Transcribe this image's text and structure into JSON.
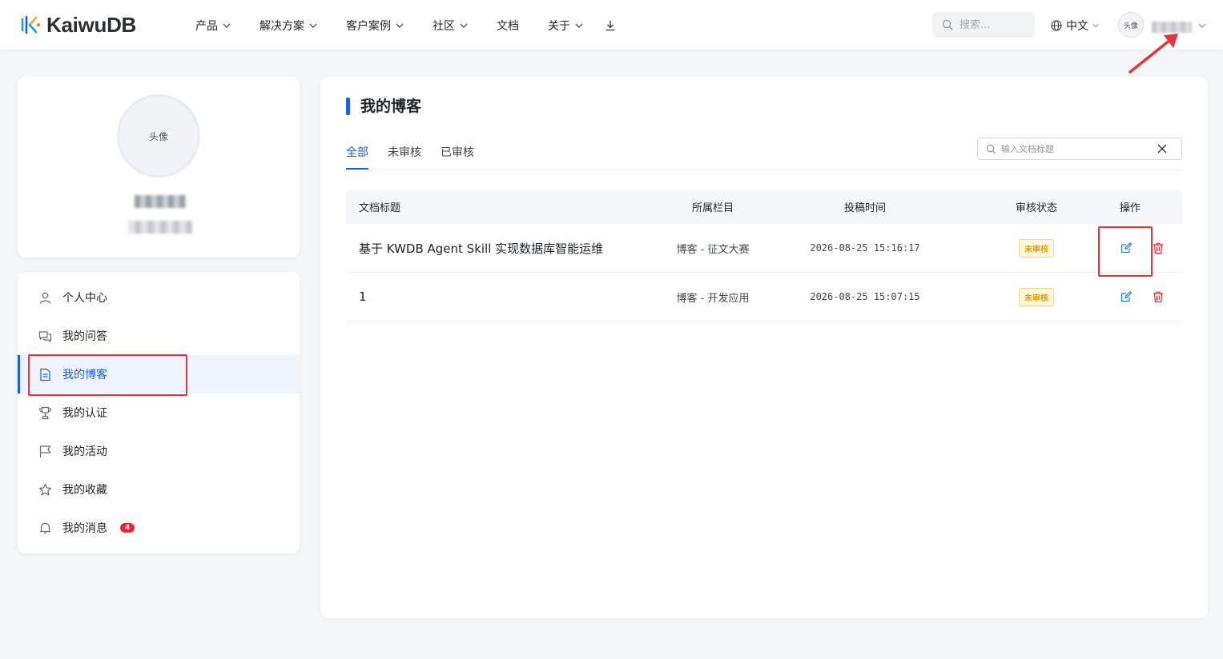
{
  "brand": {
    "name": "KaiwuDB",
    "accent": "#1a5fe8"
  },
  "nav": {
    "items": [
      {
        "label": "产品",
        "has_dropdown": true
      },
      {
        "label": "解决方案",
        "has_dropdown": true
      },
      {
        "label": "客户案例",
        "has_dropdown": true
      },
      {
        "label": "社区",
        "has_dropdown": true
      },
      {
        "label": "文档",
        "has_dropdown": false
      },
      {
        "label": "关于",
        "has_dropdown": true
      }
    ],
    "download_icon": "download-icon"
  },
  "header": {
    "search_placeholder": "搜索...",
    "language": "中文",
    "avatar_label": "头像"
  },
  "profile": {
    "avatar_label": "头像"
  },
  "sidebar": {
    "items": [
      {
        "label": "个人中心",
        "icon": "user-icon",
        "active": false
      },
      {
        "label": "我的问答",
        "icon": "chat-icon",
        "active": false
      },
      {
        "label": "我的博客",
        "icon": "document-icon",
        "active": true
      },
      {
        "label": "我的认证",
        "icon": "trophy-icon",
        "active": false
      },
      {
        "label": "我的活动",
        "icon": "flag-icon",
        "active": false
      },
      {
        "label": "我的收藏",
        "icon": "star-icon",
        "active": false
      },
      {
        "label": "我的消息",
        "icon": "bell-icon",
        "active": false,
        "badge": "4"
      }
    ]
  },
  "main": {
    "title": "我的博客",
    "tabs": [
      {
        "label": "全部",
        "active": true
      },
      {
        "label": "未审核",
        "active": false
      },
      {
        "label": "已审核",
        "active": false
      }
    ],
    "search_placeholder": "输入文档标题",
    "table": {
      "columns": [
        "文档标题",
        "所属栏目",
        "投稿时间",
        "审核状态",
        "操作"
      ],
      "rows": [
        {
          "title": "基于 KWDB Agent Skill 实现数据库智能运维",
          "category": "博客 - 征文大赛",
          "time": "2026-08-25 15:16:17",
          "status": "未审核"
        },
        {
          "title": "1",
          "category": "博客 - 开发应用",
          "time": "2026-08-25 15:07:15",
          "status": "未审核"
        }
      ]
    }
  }
}
